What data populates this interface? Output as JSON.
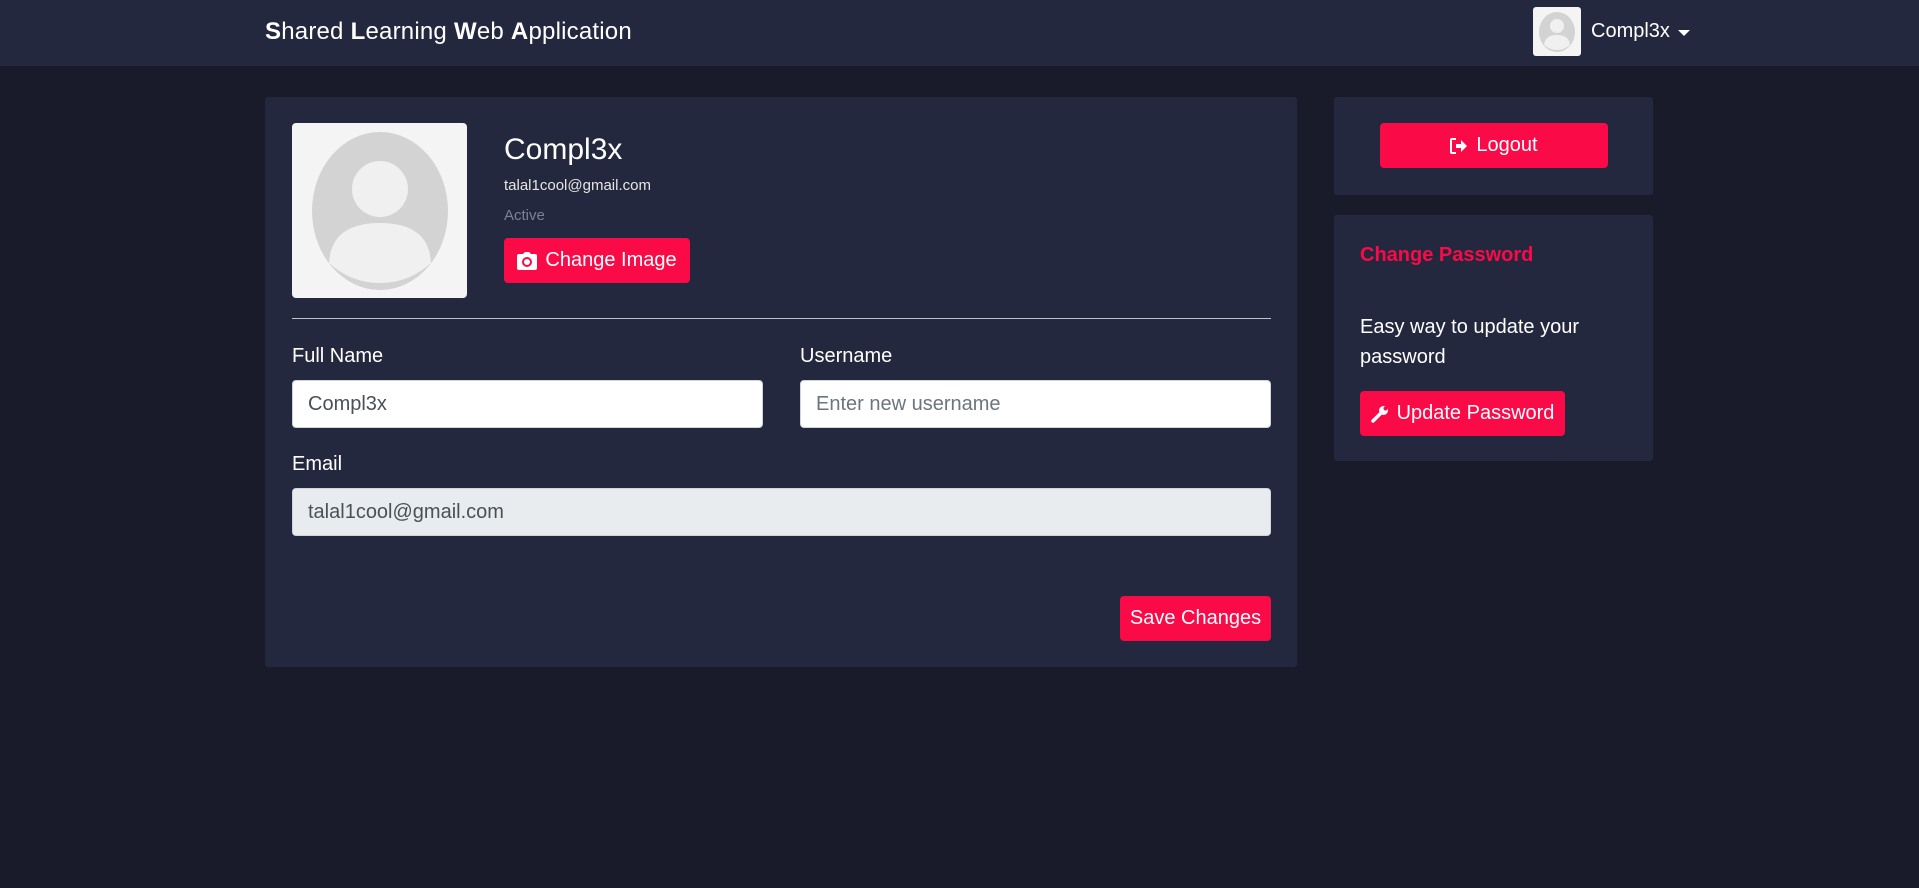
{
  "navbar": {
    "brand_words": [
      {
        "initial": "S",
        "rest": "hared"
      },
      {
        "initial": "L",
        "rest": "earning"
      },
      {
        "initial": "W",
        "rest": "eb"
      },
      {
        "initial": "A",
        "rest": "pplication"
      }
    ],
    "username": "Compl3x"
  },
  "profile": {
    "name": "Compl3x",
    "email": "talal1cool@gmail.com",
    "status": "Active",
    "change_image_label": "Change Image"
  },
  "form": {
    "full_name_label": "Full Name",
    "full_name_value": "Compl3x",
    "username_label": "Username",
    "username_placeholder": "Enter new username",
    "email_label": "Email",
    "email_value": "talal1cool@gmail.com",
    "save_label": "Save Changes"
  },
  "sidebar": {
    "logout_label": "Logout",
    "password_title": "Change Password",
    "password_desc": "Easy way to update your password",
    "update_password_label": "Update Password"
  },
  "colors": {
    "accent": "#fb0a48",
    "background": "#191b2a",
    "card": "#24283e"
  },
  "icons": {
    "camera": "camera-icon",
    "logout": "sign-out-icon",
    "wrench": "wrench-icon",
    "avatar": "user-avatar-icon"
  }
}
